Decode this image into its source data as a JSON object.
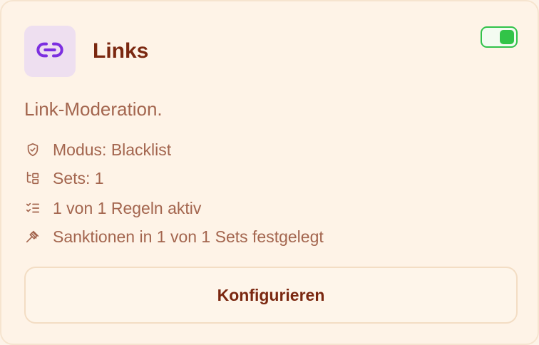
{
  "card": {
    "title": "Links",
    "description": "Link-Moderation.",
    "enabled": true,
    "icon": "link-icon",
    "accent_color": "#7c2fe0",
    "toggle_color": "#32c448"
  },
  "info": [
    {
      "icon": "shield-icon",
      "text": "Modus: Blacklist"
    },
    {
      "icon": "sets-icon",
      "text": "Sets: 1"
    },
    {
      "icon": "checklist-icon",
      "text": "1 von 1 Regeln aktiv"
    },
    {
      "icon": "gavel-icon",
      "text": "Sanktionen in 1 von 1 Sets festgelegt"
    }
  ],
  "actions": {
    "configure_label": "Konfigurieren"
  }
}
